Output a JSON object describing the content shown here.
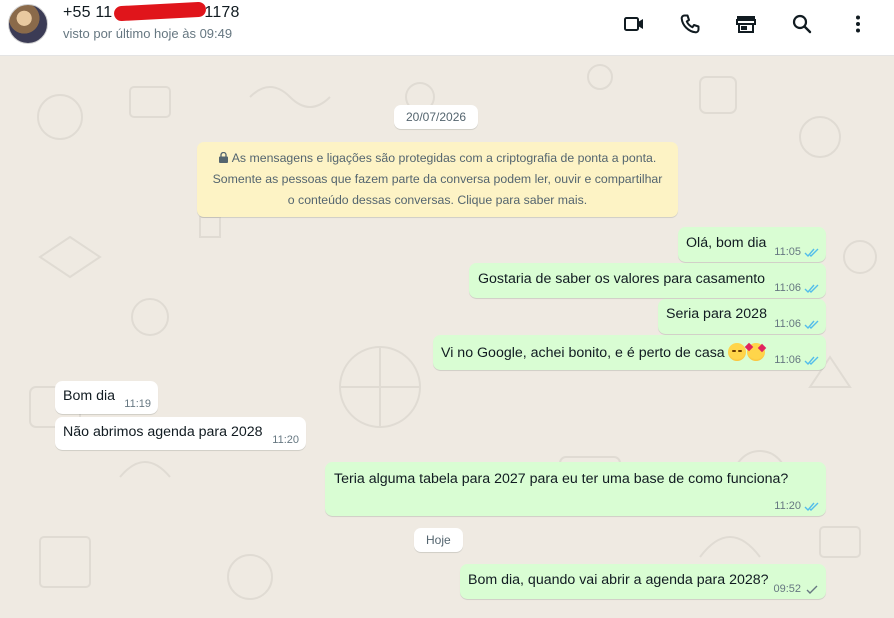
{
  "header": {
    "contact_name": "+55 11",
    "contact_name_suffix": "1178",
    "last_seen": "visto por último hoje às 09:49",
    "icons": [
      "video-call-icon",
      "voice-call-icon",
      "catalog-icon",
      "search-icon",
      "menu-icon"
    ]
  },
  "chat": {
    "date_chip": "20/07/2026",
    "encryption_notice": {
      "line1": "As mensagens e ligações são protegidas com a criptografia de ponta a ponta.",
      "line2": "Somente as pessoas que fazem parte da conversa podem ler, ouvir e compartilhar",
      "line3": "o conteúdo dessas conversas. Clique para saber mais."
    },
    "today_chip": "Hoje",
    "messages": [
      {
        "direction": "out",
        "text": "Olá, bom dia",
        "time": "11:05",
        "status": "read"
      },
      {
        "direction": "out",
        "text": "Gostaria de saber os valores para casamento",
        "time": "11:06",
        "status": "read"
      },
      {
        "direction": "out",
        "text": "Seria para 2028",
        "time": "11:06",
        "status": "read"
      },
      {
        "direction": "out",
        "text": "Vi no Google, achei bonito, e é perto de casa",
        "time": "11:06",
        "status": "read",
        "emojis": [
          "kissing-face-emoji",
          "smiling-face-with-hearts-emoji"
        ]
      },
      {
        "direction": "in",
        "text": "Bom dia",
        "time": "11:19"
      },
      {
        "direction": "in",
        "text": "Não abrimos agenda para 2028",
        "time": "11:20"
      },
      {
        "direction": "out",
        "text": "Teria alguma tabela para 2027 para eu ter uma base de como funciona?",
        "time": "11:20",
        "status": "read"
      },
      {
        "direction": "out",
        "text": "Bom dia, quando vai abrir a agenda para 2028?",
        "time": "09:52",
        "status": "sent"
      }
    ]
  },
  "colors": {
    "outgoing_bubble": "#d9fdd3",
    "incoming_bubble": "#ffffff",
    "chat_background": "#efeae2",
    "notice_background": "#fdf3c5",
    "read_ticks": "#53bdeb",
    "sent_tick": "#667781",
    "redaction": "#e0151b"
  }
}
